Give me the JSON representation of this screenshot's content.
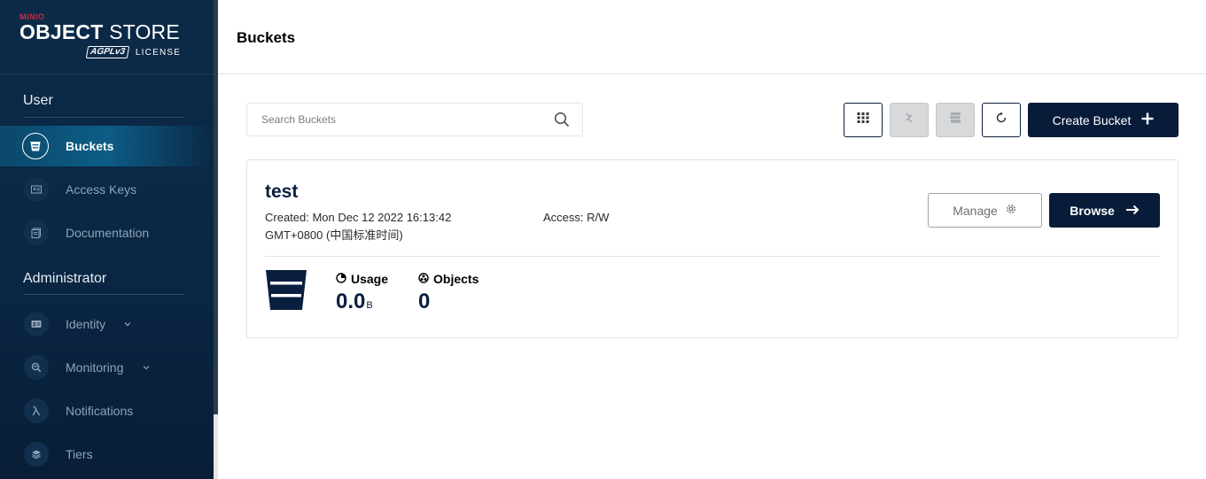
{
  "sidebar": {
    "logo": {
      "brand": "MINIO",
      "product_bold": "OBJECT",
      "product_rest": " STORE",
      "agpl": "AGPLv3",
      "license": "LICENSE"
    },
    "sections": [
      {
        "title": "User"
      },
      {
        "title": "Administrator"
      }
    ],
    "items": [
      {
        "label": "Buckets",
        "icon": "bucket-icon"
      },
      {
        "label": "Access Keys",
        "icon": "key-card-icon"
      },
      {
        "label": "Documentation",
        "icon": "documentation-icon"
      },
      {
        "label": "Identity",
        "icon": "identity-icon"
      },
      {
        "label": "Monitoring",
        "icon": "monitoring-icon"
      },
      {
        "label": "Notifications",
        "icon": "lambda-icon"
      },
      {
        "label": "Tiers",
        "icon": "tiers-icon"
      }
    ]
  },
  "header": {
    "title": "Buckets"
  },
  "search": {
    "placeholder": "Search Buckets",
    "value": ""
  },
  "toolbar": {
    "create_label": "Create Bucket"
  },
  "buckets": [
    {
      "name": "test",
      "created": "Created: Mon Dec 12 2022 16:13:42 GMT+0800 (中国标准时间)",
      "access": "Access: R/W",
      "manage_label": "Manage",
      "browse_label": "Browse",
      "usage_label": "Usage",
      "usage_value": "0.0",
      "usage_unit": "B",
      "objects_label": "Objects",
      "objects_value": "0"
    }
  ],
  "colors": {
    "sidebar_bg": "#0a2642",
    "accent_dark": "#081c3a",
    "brand_red": "#c72c48"
  }
}
